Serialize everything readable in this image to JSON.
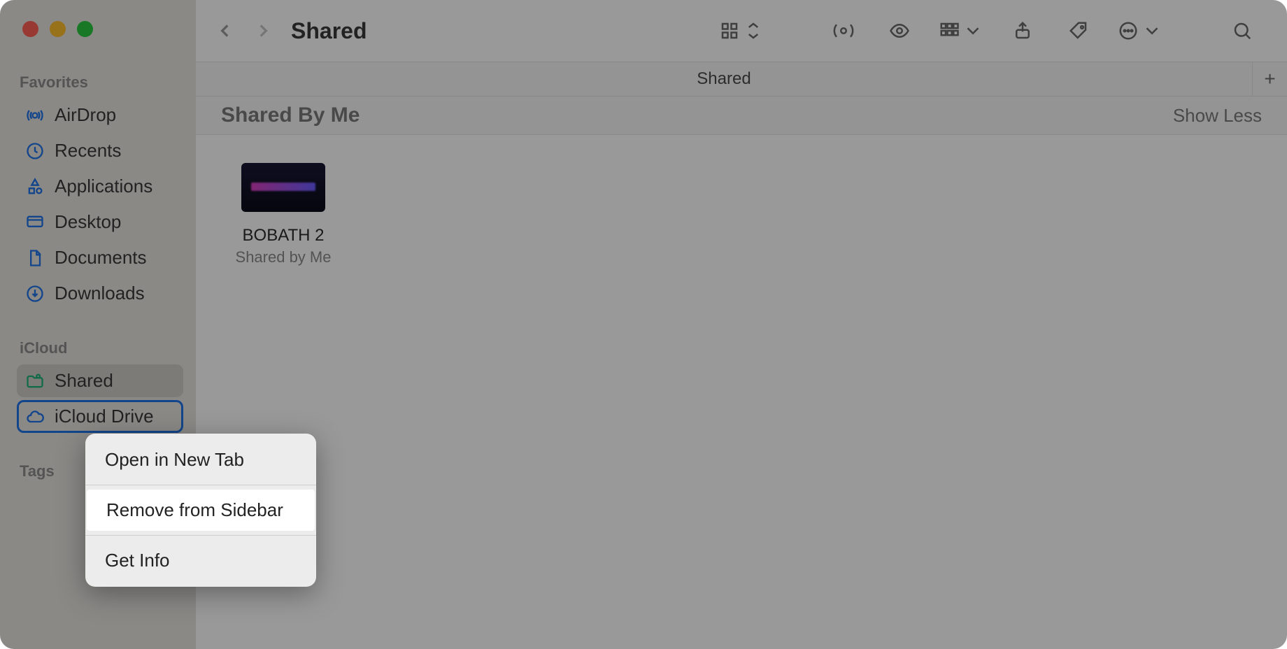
{
  "window_title": "Shared",
  "sidebar": {
    "favorites_header": "Favorites",
    "icloud_header": "iCloud",
    "tags_header": "Tags",
    "favorites": [
      {
        "label": "AirDrop",
        "icon": "airdrop"
      },
      {
        "label": "Recents",
        "icon": "clock"
      },
      {
        "label": "Applications",
        "icon": "apps"
      },
      {
        "label": "Desktop",
        "icon": "desktop"
      },
      {
        "label": "Documents",
        "icon": "document"
      },
      {
        "label": "Downloads",
        "icon": "download"
      }
    ],
    "icloud": [
      {
        "label": "Shared",
        "icon": "shared-folder",
        "selected": true
      },
      {
        "label": "iCloud Drive",
        "icon": "cloud",
        "focused": true
      }
    ]
  },
  "tabbar": {
    "tab_label": "Shared"
  },
  "section": {
    "title": "Shared By Me",
    "toggle": "Show Less"
  },
  "files": [
    {
      "name": "BOBATH 2",
      "subtitle": "Shared by Me"
    }
  ],
  "context_menu": {
    "items": [
      "Open in New Tab",
      "Remove from Sidebar",
      "Get Info"
    ],
    "highlighted_index": 1
  }
}
